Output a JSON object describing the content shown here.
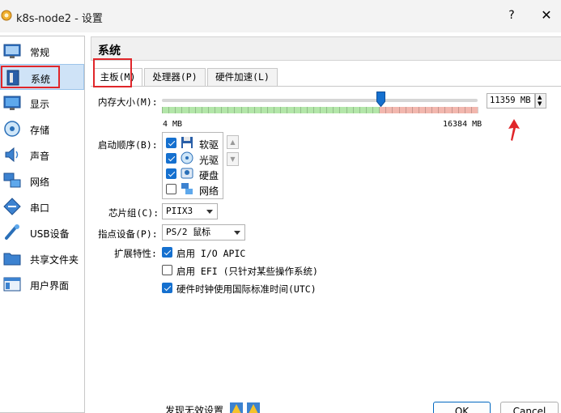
{
  "window": {
    "title": "k8s-node2 - 设置",
    "help": "?",
    "close": "✕"
  },
  "sidebar": {
    "items": [
      {
        "label": "常规",
        "icon": "general-icon"
      },
      {
        "label": "系统",
        "icon": "system-icon",
        "selected": true
      },
      {
        "label": "显示",
        "icon": "display-icon"
      },
      {
        "label": "存储",
        "icon": "storage-icon"
      },
      {
        "label": "声音",
        "icon": "audio-icon"
      },
      {
        "label": "网络",
        "icon": "network-icon"
      },
      {
        "label": "串口",
        "icon": "serial-port-icon"
      },
      {
        "label": "USB设备",
        "icon": "usb-icon"
      },
      {
        "label": "共享文件夹",
        "icon": "shared-folder-icon"
      },
      {
        "label": "用户界面",
        "icon": "user-interface-icon"
      }
    ]
  },
  "main": {
    "section_title": "系统",
    "tabs": [
      {
        "label": "主板(M)",
        "active": true
      },
      {
        "label": "处理器(P)"
      },
      {
        "label": "硬件加速(L)"
      }
    ],
    "memory": {
      "label": "内存大小(M):",
      "value": "11359 MB",
      "value_mb": 11359,
      "min_label": "4 MB",
      "max_label": "16384 MB",
      "min_mb": 4,
      "max_mb": 16384,
      "recommended_limit_fraction": 0.69
    },
    "boot_order": {
      "label": "启动顺序(B):",
      "items": [
        {
          "label": "软驱",
          "checked": true,
          "icon": "floppy-icon"
        },
        {
          "label": "光驱",
          "checked": true,
          "icon": "optical-drive-icon"
        },
        {
          "label": "硬盘",
          "checked": true,
          "icon": "hard-disk-icon"
        },
        {
          "label": "网络",
          "checked": false,
          "icon": "network-boot-icon"
        }
      ]
    },
    "chipset": {
      "label": "芯片组(C):",
      "value": "PIIX3"
    },
    "pointing_device": {
      "label": "指点设备(P):",
      "value": "PS/2 鼠标"
    },
    "extended_features": {
      "label": "扩展特性:",
      "items": [
        {
          "label": "启用 I/O APIC",
          "checked": true
        },
        {
          "label": "启用 EFI (只针对某些操作系统)",
          "checked": false
        },
        {
          "label": "硬件时钟使用国际标准时间(UTC)",
          "checked": true
        }
      ]
    }
  },
  "footer": {
    "invalid_settings_text": "发现无效设置",
    "ok_label": "OK",
    "cancel_label": "Cancel"
  },
  "colors": {
    "selection": "#cfe3f7",
    "annotation_red": "#e0262a",
    "checkbox_blue": "#1570cf",
    "slider_green": "#b3e6a9",
    "slider_red": "#f2b7ae",
    "slider_handle": "#1570cf"
  }
}
